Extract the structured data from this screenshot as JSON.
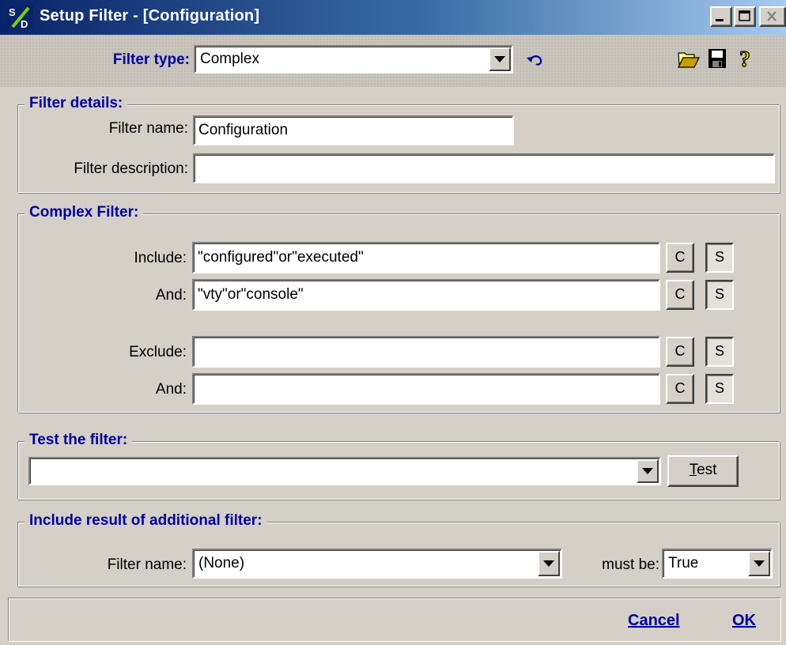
{
  "window": {
    "title": "Setup Filter - [Configuration]",
    "app_icon": "sd-app-icon"
  },
  "toolbar": {
    "filter_type_label": "Filter type:",
    "filter_type_value": "Complex",
    "undo_icon": "undo-icon",
    "open_icon": "folder-open-icon",
    "save_icon": "floppy-save-icon",
    "help_icon": "help-question-icon"
  },
  "filter_details": {
    "title": "Filter details:",
    "name_label": "Filter name:",
    "name_value": "Configuration",
    "description_label": "Filter description:",
    "description_value": ""
  },
  "complex_filter": {
    "title": "Complex Filter:",
    "rows": [
      {
        "label": "Include:",
        "value": "\"configured\"or\"executed\"",
        "c": "C",
        "s": "S"
      },
      {
        "label": "And:",
        "value": "\"vty\"or\"console\"",
        "c": "C",
        "s": "S"
      },
      {
        "label": "Exclude:",
        "value": "",
        "c": "C",
        "s": "S"
      },
      {
        "label": "And:",
        "value": "",
        "c": "C",
        "s": "S"
      }
    ]
  },
  "test": {
    "title": "Test the filter:",
    "value": "",
    "button_prefix": "",
    "button_mnemonic": "T",
    "button_rest": "est"
  },
  "additional": {
    "title": "Include result of additional filter:",
    "name_label": "Filter name:",
    "name_value": "(None)",
    "must_be_label": "must be:",
    "must_be_value": "True"
  },
  "footer": {
    "cancel_label": "Cancel",
    "ok_label": "OK"
  },
  "colors": {
    "title_bar_start": "#0a246a",
    "title_bar_end": "#a6caf0",
    "accent_text": "#0000a0",
    "window_bg": "#d4d0c8"
  }
}
